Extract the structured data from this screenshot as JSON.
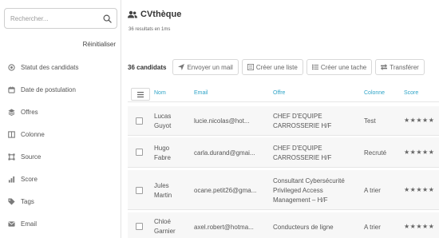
{
  "sidebar": {
    "search": {
      "placeholder": "Rechercher..."
    },
    "reset_label": "Réinitialiser",
    "filters": [
      {
        "label": "Statut des candidats",
        "icon": "circle-icon"
      },
      {
        "label": "Date de postulation",
        "icon": "calendar-icon"
      },
      {
        "label": "Offres",
        "icon": "layers-icon"
      },
      {
        "label": "Colonne",
        "icon": "columns-icon"
      },
      {
        "label": "Source",
        "icon": "source-icon"
      },
      {
        "label": "Score",
        "icon": "bars-icon"
      },
      {
        "label": "Tags",
        "icon": "tag-icon"
      },
      {
        "label": "Email",
        "icon": "envelope-icon"
      }
    ]
  },
  "main": {
    "title": "CVthèque",
    "results": "36 resultats en 1ms",
    "toolbar": {
      "count": "36 candidats",
      "send_mail": "Envoyer un mail",
      "create_list": "Créer une liste",
      "create_task": "Créer une tache",
      "transfer": "Transférer"
    },
    "table": {
      "headers": {
        "name": "Nom",
        "email": "Email",
        "offer": "Offre",
        "column": "Colonne",
        "score": "Score"
      },
      "rows": [
        {
          "first": "Lucas",
          "last": "Guyot",
          "email": "lucie.nicolas@hot...",
          "offer": [
            "CHEF D'EQUIPE",
            "CARROSSERIE H/F"
          ],
          "column": "Test",
          "stars": "★★★★★"
        },
        {
          "first": "Hugo",
          "last": "Fabre",
          "email": "carla.durand@gmai...",
          "offer": [
            "CHEF D'EQUIPE",
            "CARROSSERIE H/F"
          ],
          "column": "Recruté",
          "stars": "★★★★★"
        },
        {
          "first": "Jules",
          "last": "Martin",
          "email": "ocane.petit26@gma...",
          "offer": [
            "Consultant Cybersécurité",
            "Privileged Access",
            "Management – H/F"
          ],
          "column": "A trier",
          "stars": "★★★★★"
        },
        {
          "first": "Chloé",
          "last": "Garnier",
          "email": "axel.robert@hotma...",
          "offer": [
            "Conducteurs de ligne"
          ],
          "column": "A trier",
          "stars": "★★★★★"
        }
      ]
    }
  },
  "colors": {
    "accent": "#2fa4c7",
    "row_bg": "#f7f7f7",
    "border": "#e3e3e3"
  }
}
